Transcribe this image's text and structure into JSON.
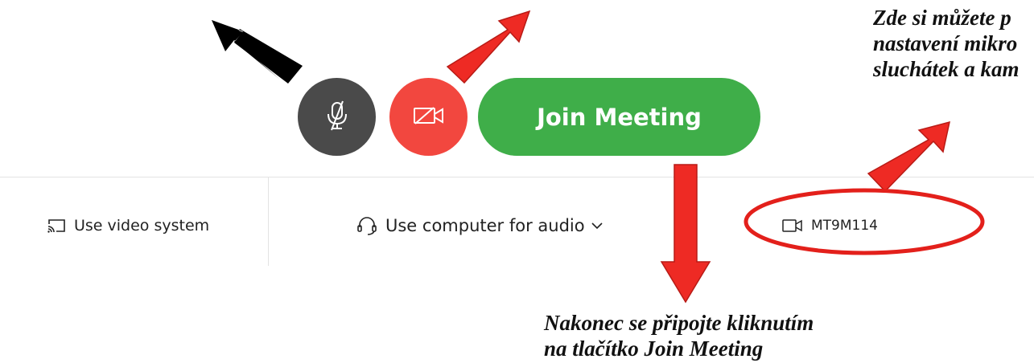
{
  "meeting": {
    "join_label": "Join Meeting",
    "mute_icon": "microphone-muted-icon",
    "video_icon": "video-off-icon"
  },
  "options": {
    "video_system_label": "Use video system",
    "audio_label": "Use computer for audio",
    "camera_label": "MT9M114"
  },
  "annotations": {
    "top_right_lines": [
      "Zde si můžete p",
      "nastavení mikro",
      "sluchátek a kam"
    ],
    "bottom_lines": [
      "Nakonec se připojte kliknutím",
      "na tlačítko Join Meeting"
    ]
  },
  "colors": {
    "join_green": "#3fae49",
    "video_red": "#f2473f",
    "mute_gray": "#4a4a4a",
    "arrow_red": "#ee2a24",
    "arrow_black": "#000000"
  }
}
